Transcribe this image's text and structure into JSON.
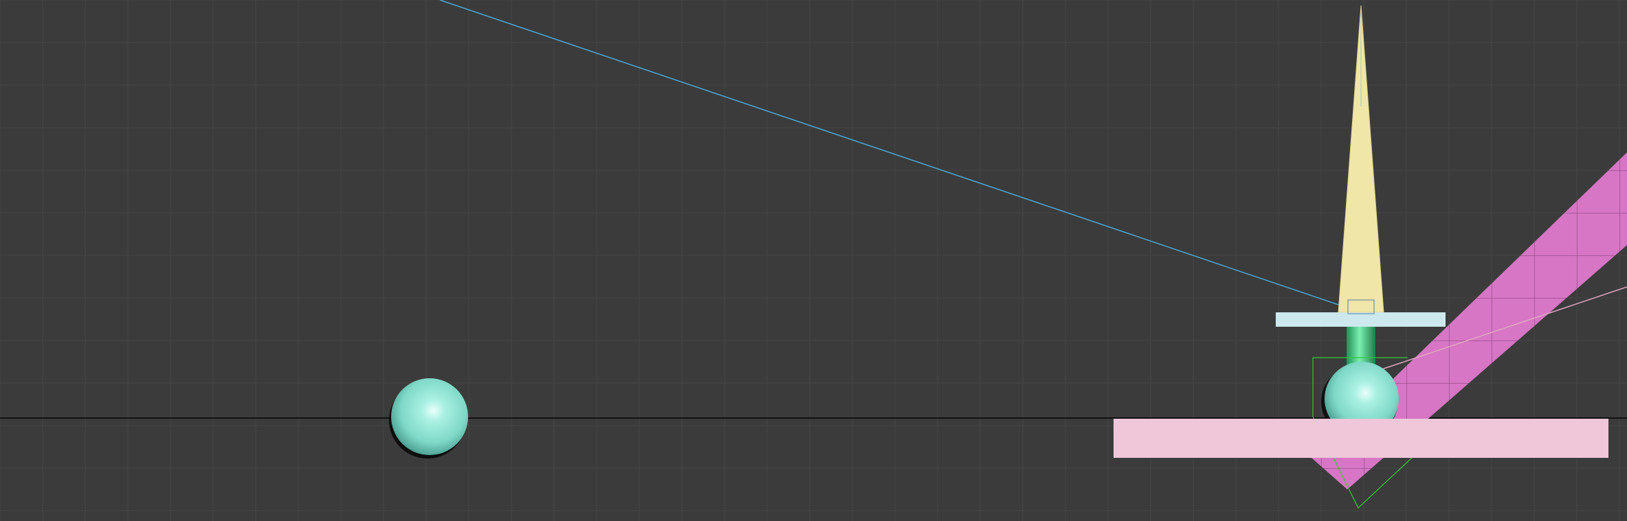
{
  "scene": {
    "type": "3d-viewport-front-view",
    "background_color": "#3b3b3b",
    "grid_color": "#454545",
    "horizon_color": "#111111",
    "objects": [
      {
        "name": "sphere-left",
        "kind": "sphere",
        "color": "#8fe6d6"
      },
      {
        "name": "sphere-right",
        "kind": "sphere",
        "color": "#8fe6d6"
      },
      {
        "name": "cone-spike",
        "kind": "cone",
        "color": "#efe6a8"
      },
      {
        "name": "top-plate",
        "kind": "box",
        "color": "#cde9ee"
      },
      {
        "name": "green-cylinder",
        "kind": "cylinder",
        "color": "#3fc97f"
      },
      {
        "name": "pink-floor-box",
        "kind": "box",
        "color": "#efc7d8"
      },
      {
        "name": "magenta-diagonal-beam",
        "kind": "box",
        "color": "#d676c4"
      },
      {
        "name": "blue-guide-line",
        "kind": "line",
        "color": "#4aa8d8"
      },
      {
        "name": "pink-guide-line",
        "kind": "line",
        "color": "#d9a7be"
      },
      {
        "name": "selection-gizmo",
        "kind": "gizmo",
        "color": "#33cc33"
      }
    ]
  }
}
